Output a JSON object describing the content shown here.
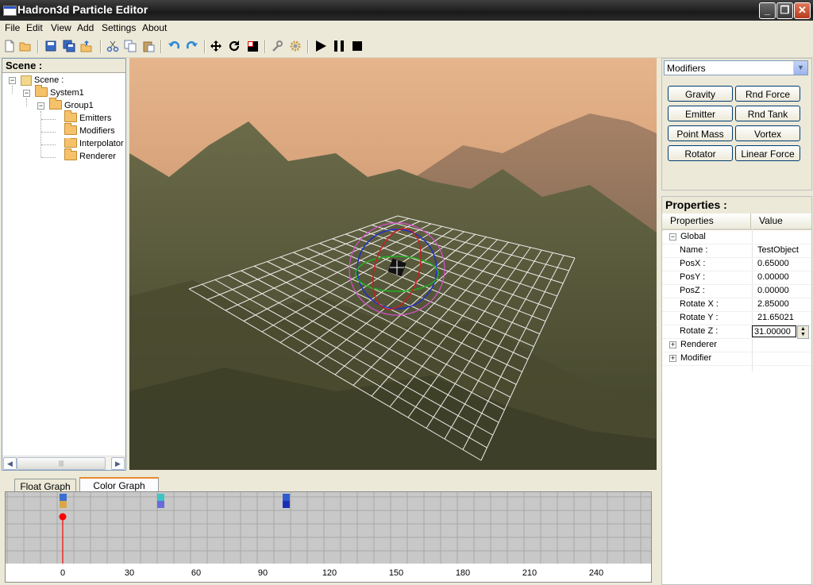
{
  "window": {
    "title": "Hadron3d Particle Editor"
  },
  "menu": [
    "File",
    "Edit",
    "View",
    "Add",
    "Settings",
    "About"
  ],
  "toolbar": {
    "icons": [
      "new-file-icon",
      "open-folder-icon",
      "save-icon",
      "save-all-icon",
      "export-icon",
      "cut-icon",
      "copy-icon",
      "paste-icon",
      "undo-icon",
      "redo-icon",
      "move-icon",
      "rotate-icon",
      "scale-icon",
      "wrench-icon",
      "gear-icon",
      "play-icon",
      "pause-icon",
      "stop-icon"
    ]
  },
  "scene": {
    "header": "Scene :",
    "root": "Scene :",
    "system": "System1",
    "group": "Group1",
    "children": [
      "Emitters",
      "Modifiers",
      "Interpolator",
      "Renderer"
    ]
  },
  "modifiers": {
    "selected": "Modifiers",
    "buttons": [
      "Gravity",
      "Rnd Force",
      "Emitter",
      "Rnd Tank",
      "Point Mass",
      "Vortex",
      "Rotator",
      "Linear Force"
    ]
  },
  "properties": {
    "header": "Properties :",
    "col_name": "Properties",
    "col_value": "Value",
    "categories": {
      "global": "Global",
      "renderer": "Renderer",
      "modifier": "Modifier"
    },
    "rows": [
      {
        "name": "Name :",
        "value": "TestObject"
      },
      {
        "name": "PosX :",
        "value": "0.65000"
      },
      {
        "name": "PosY :",
        "value": "0.00000"
      },
      {
        "name": "PosZ :",
        "value": "0.00000"
      },
      {
        "name": "Rotate X :",
        "value": "2.85000"
      },
      {
        "name": "Rotate Y :",
        "value": "21.65021"
      },
      {
        "name": "Rotate Z :",
        "value": "31.00000"
      }
    ]
  },
  "graph": {
    "tabs": [
      "Float Graph",
      "Color Graph"
    ],
    "active_tab": "Color Graph",
    "x_labels": [
      "0",
      "30",
      "60",
      "90",
      "120",
      "150",
      "180",
      "210",
      "240"
    ],
    "marker_x": 0
  },
  "colors": {
    "accent": "#0a246a",
    "selection": "#316ac5",
    "marker": "#ff0000"
  }
}
